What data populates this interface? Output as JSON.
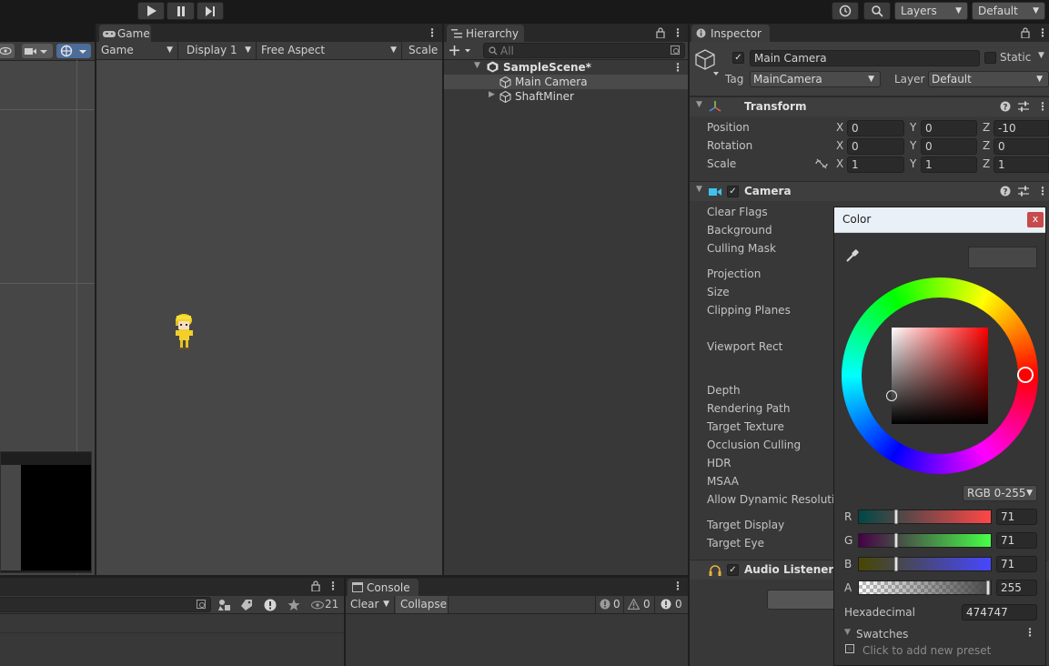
{
  "toolbar": {
    "play_icon": "play-icon",
    "pause_icon": "pause-icon",
    "step_icon": "step-icon",
    "history_icon": "history-icon",
    "search_icon": "search-icon",
    "layers_label": "Layers",
    "layout_label": "Default"
  },
  "game": {
    "tab_label": "Game",
    "mode_label": "Game",
    "display_label": "Display 1",
    "aspect_label": "Free Aspect",
    "scale_label": "Scale"
  },
  "hierarchy": {
    "tab_label": "Hierarchy",
    "search_placeholder": "All",
    "scene_name": "SampleScene*",
    "items": [
      {
        "label": "Main Camera"
      },
      {
        "label": "ShaftMiner"
      }
    ]
  },
  "inspector": {
    "tab_label": "Inspector",
    "object_name": "Main Camera",
    "static_label": "Static",
    "tag_label": "Tag",
    "tag_value": "MainCamera",
    "layer_label": "Layer",
    "layer_value": "Default",
    "transform": {
      "title": "Transform",
      "rows": [
        {
          "label": "Position",
          "x": "0",
          "y": "0",
          "z": "-10"
        },
        {
          "label": "Rotation",
          "x": "0",
          "y": "0",
          "z": "0"
        },
        {
          "label": "Scale",
          "x": "1",
          "y": "1",
          "z": "1"
        }
      ],
      "axis_x": "X",
      "axis_y": "Y",
      "axis_z": "Z"
    },
    "camera": {
      "title": "Camera",
      "properties": [
        "Clear Flags",
        "Background",
        "Culling Mask",
        "Projection",
        "Size",
        "Clipping Planes",
        "Viewport Rect",
        "Depth",
        "Rendering Path",
        "Target Texture",
        "Occlusion Culling",
        "HDR",
        "MSAA",
        "Allow Dynamic Resolutio",
        "Target Display",
        "Target Eye"
      ]
    },
    "audio_listener": {
      "title": "Audio Listener"
    }
  },
  "console": {
    "tab_label": "Console",
    "clear_label": "Clear",
    "collapse_label": "Collapse",
    "log_count": "0",
    "warning_count": "0",
    "error_count": "0"
  },
  "project": {
    "hidden_count": "21"
  },
  "color_picker": {
    "title": "Color",
    "close_label": "x",
    "mode_label": "RGB 0-255",
    "r_label": "R",
    "r_value": "71",
    "g_label": "G",
    "g_value": "71",
    "b_label": "B",
    "b_value": "71",
    "a_label": "A",
    "a_value": "255",
    "hex_label": "Hexadecimal",
    "hex_value": "474747",
    "swatches_label": "Swatches",
    "add_preset_label": "Click to add new preset",
    "current_color": "#474747",
    "hue_color": "#ff0000"
  }
}
